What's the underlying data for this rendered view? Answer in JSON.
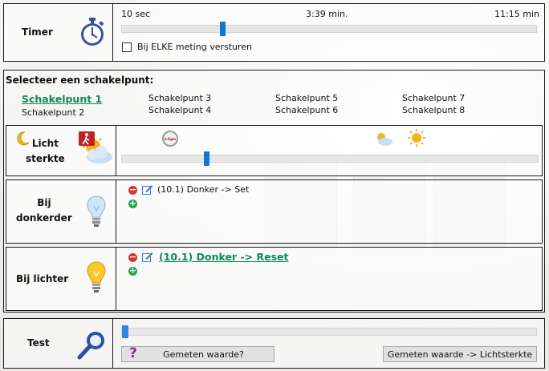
{
  "timer": {
    "label": "Timer",
    "min_label": "10 sec",
    "mid_label": "3:39 min.",
    "max_label": "11:15 min",
    "slider_value": 0.24,
    "checkbox_label": "Bij ELKE meting versturen",
    "checkbox_checked": false
  },
  "schakelpunt": {
    "heading": "Selecteer een schakelpunt:",
    "items": [
      {
        "label": "Schakelpunt 1",
        "active": true
      },
      {
        "label": "Schakelpunt 2",
        "active": false
      },
      {
        "label": "Schakelpunt 3",
        "active": false
      },
      {
        "label": "Schakelpunt 4",
        "active": false
      },
      {
        "label": "Schakelpunt 5",
        "active": false
      },
      {
        "label": "Schakelpunt 6",
        "active": false
      },
      {
        "label": "Schakelpunt 7",
        "active": false
      },
      {
        "label": "Schakelpunt 8",
        "active": false
      }
    ]
  },
  "lichtsterkte": {
    "label_line1": "Licht",
    "label_line2": "sterkte",
    "slider_value": 0.2,
    "badge_text": "b-Egio"
  },
  "donkerder": {
    "label_line1": "Bij",
    "label_line2": "donkerder",
    "rule_text": "(10.1) Donker -> Set"
  },
  "lichter": {
    "label": "Bij lichter",
    "rule_text": "(10.1) Donker -> Reset"
  },
  "test": {
    "label": "Test",
    "progress_value": 0.015,
    "measure_button": "Gemeten waarde?",
    "question_mark": "?",
    "apply_button": "Gemeten waarde -> Lichtsterkte"
  },
  "colors": {
    "accent": "#0a78d7",
    "link_green": "#0d8a58",
    "border": "#1a1a1a"
  }
}
